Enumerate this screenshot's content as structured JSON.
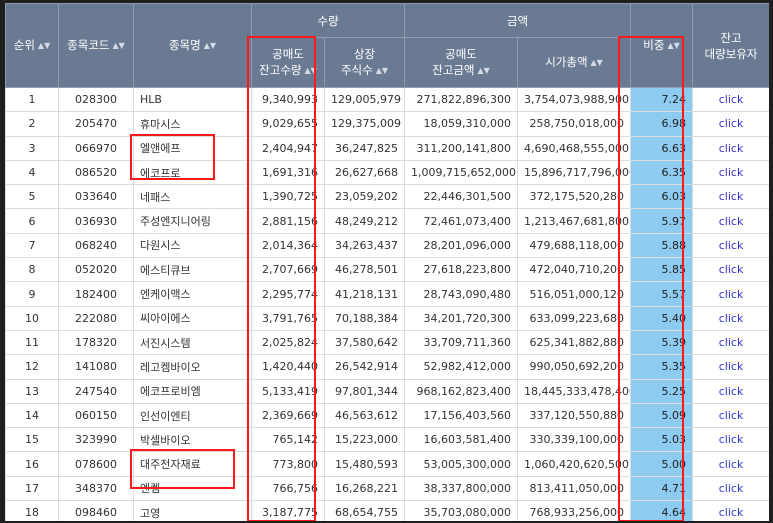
{
  "header": {
    "group_qty": "수량",
    "group_amount": "금액",
    "rank": "순위",
    "code": "종목코드",
    "name": "종목명",
    "short_qty": [
      "공매도",
      "잔고수량"
    ],
    "listed_shares": [
      "상장",
      "주식수"
    ],
    "short_amount": [
      "공매도",
      "잔고금액"
    ],
    "market_cap": "시가총액",
    "weight": "비중",
    "holder": [
      "잔고",
      "대량보유자"
    ],
    "sort_icon": "sort-icon"
  },
  "rows": [
    {
      "rank": "1",
      "code": "028300",
      "name": "HLB",
      "short_qty": "9,340,993",
      "listed": "129,005,979",
      "short_amt": "271,822,896,300",
      "mcap": "3,754,073,988,900",
      "weight": "7.24",
      "link": "click"
    },
    {
      "rank": "2",
      "code": "205470",
      "name": "휴마시스",
      "short_qty": "9,029,655",
      "listed": "129,375,009",
      "short_amt": "18,059,310,000",
      "mcap": "258,750,018,000",
      "weight": "6.98",
      "link": "click"
    },
    {
      "rank": "3",
      "code": "066970",
      "name": "엘앤에프",
      "short_qty": "2,404,947",
      "listed": "36,247,825",
      "short_amt": "311,200,141,800",
      "mcap": "4,690,468,555,000",
      "weight": "6.63",
      "link": "click"
    },
    {
      "rank": "4",
      "code": "086520",
      "name": "에코프로",
      "short_qty": "1,691,316",
      "listed": "26,627,668",
      "short_amt": "1,009,715,652,000",
      "mcap": "15,896,717,796,000",
      "weight": "6.35",
      "link": "click"
    },
    {
      "rank": "5",
      "code": "033640",
      "name": "네패스",
      "short_qty": "1,390,725",
      "listed": "23,059,202",
      "short_amt": "22,446,301,500",
      "mcap": "372,175,520,280",
      "weight": "6.03",
      "link": "click"
    },
    {
      "rank": "6",
      "code": "036930",
      "name": "주성엔지니어링",
      "short_qty": "2,881,156",
      "listed": "48,249,212",
      "short_amt": "72,461,073,400",
      "mcap": "1,213,467,681,800",
      "weight": "5.97",
      "link": "click"
    },
    {
      "rank": "7",
      "code": "068240",
      "name": "다원시스",
      "short_qty": "2,014,364",
      "listed": "34,263,437",
      "short_amt": "28,201,096,000",
      "mcap": "479,688,118,000",
      "weight": "5.88",
      "link": "click"
    },
    {
      "rank": "8",
      "code": "052020",
      "name": "에스티큐브",
      "short_qty": "2,707,669",
      "listed": "46,278,501",
      "short_amt": "27,618,223,800",
      "mcap": "472,040,710,200",
      "weight": "5.85",
      "link": "click"
    },
    {
      "rank": "9",
      "code": "182400",
      "name": "엔케이맥스",
      "short_qty": "2,295,774",
      "listed": "41,218,131",
      "short_amt": "28,743,090,480",
      "mcap": "516,051,000,120",
      "weight": "5.57",
      "link": "click"
    },
    {
      "rank": "10",
      "code": "222080",
      "name": "씨아이에스",
      "short_qty": "3,791,765",
      "listed": "70,188,384",
      "short_amt": "34,201,720,300",
      "mcap": "633,099,223,680",
      "weight": "5.40",
      "link": "click"
    },
    {
      "rank": "11",
      "code": "178320",
      "name": "서진시스템",
      "short_qty": "2,025,824",
      "listed": "37,580,642",
      "short_amt": "33,709,711,360",
      "mcap": "625,341,882,880",
      "weight": "5.39",
      "link": "click"
    },
    {
      "rank": "12",
      "code": "141080",
      "name": "레고켐바이오",
      "short_qty": "1,420,440",
      "listed": "26,542,914",
      "short_amt": "52,982,412,000",
      "mcap": "990,050,692,200",
      "weight": "5.35",
      "link": "click"
    },
    {
      "rank": "13",
      "code": "247540",
      "name": "에코프로비엠",
      "short_qty": "5,133,419",
      "listed": "97,801,344",
      "short_amt": "968,162,823,400",
      "mcap": "18,445,333,478,400",
      "weight": "5.25",
      "link": "click"
    },
    {
      "rank": "14",
      "code": "060150",
      "name": "인선이엔티",
      "short_qty": "2,369,669",
      "listed": "46,563,612",
      "short_amt": "17,156,403,560",
      "mcap": "337,120,550,880",
      "weight": "5.09",
      "link": "click"
    },
    {
      "rank": "15",
      "code": "323990",
      "name": "박셀바이오",
      "short_qty": "765,142",
      "listed": "15,223,000",
      "short_amt": "16,603,581,400",
      "mcap": "330,339,100,000",
      "weight": "5.03",
      "link": "click"
    },
    {
      "rank": "16",
      "code": "078600",
      "name": "대주전자재료",
      "short_qty": "773,800",
      "listed": "15,480,593",
      "short_amt": "53,005,300,000",
      "mcap": "1,060,420,620,500",
      "weight": "5.00",
      "link": "click"
    },
    {
      "rank": "17",
      "code": "348370",
      "name": "엔켐",
      "short_qty": "766,756",
      "listed": "16,268,221",
      "short_amt": "38,337,800,000",
      "mcap": "813,411,050,000",
      "weight": "4.71",
      "link": "click"
    },
    {
      "rank": "18",
      "code": "098460",
      "name": "고영",
      "short_qty": "3,187,775",
      "listed": "68,654,755",
      "short_amt": "35,703,080,000",
      "mcap": "768,933,256,000",
      "weight": "4.64",
      "link": "click"
    }
  ],
  "colors": {
    "header_bg": "#6b7a93",
    "weight_bg": "#8ecbf0",
    "annotation": "#ff1a1a",
    "link": "#3333cc"
  }
}
